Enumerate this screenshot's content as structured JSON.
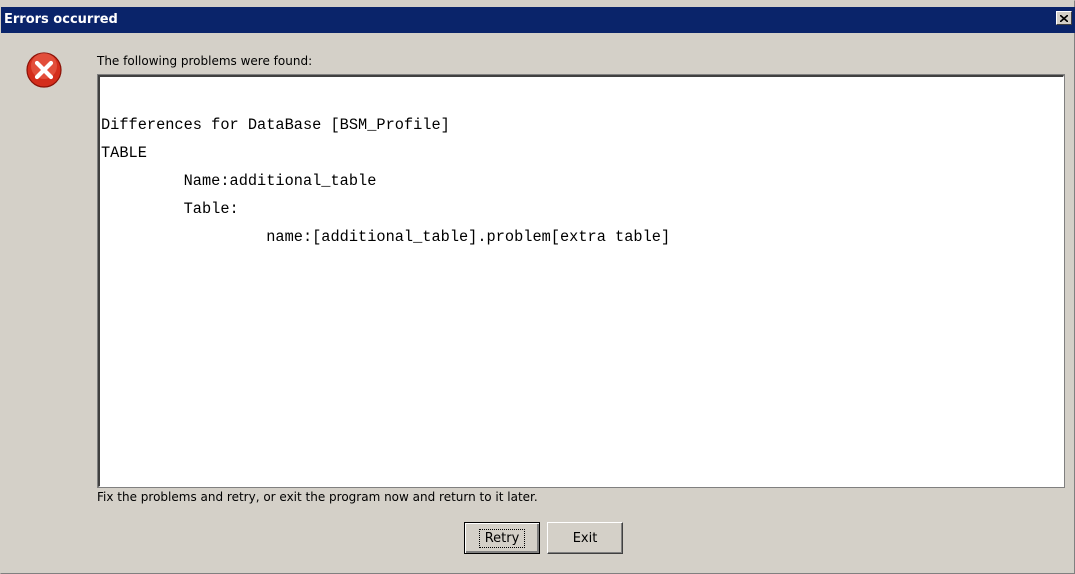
{
  "window": {
    "title": "Errors occurred"
  },
  "icons": {
    "error": "error-icon",
    "close": "close-icon"
  },
  "colors": {
    "titlebar": "#0a246a",
    "error_red": "#d42d1c",
    "dialog_bg": "#d4d0c8"
  },
  "dialog": {
    "prompt": "The following problems were found:",
    "details_lines": [
      "Differences for DataBase [BSM_Profile]",
      "TABLE",
      "         Name:additional_table",
      "         Table:",
      "                  name:[additional_table].problem[extra table]"
    ],
    "footer": "Fix the problems and retry, or exit the program now and return to it later."
  },
  "buttons": {
    "retry": "Retry",
    "exit": "Exit"
  }
}
